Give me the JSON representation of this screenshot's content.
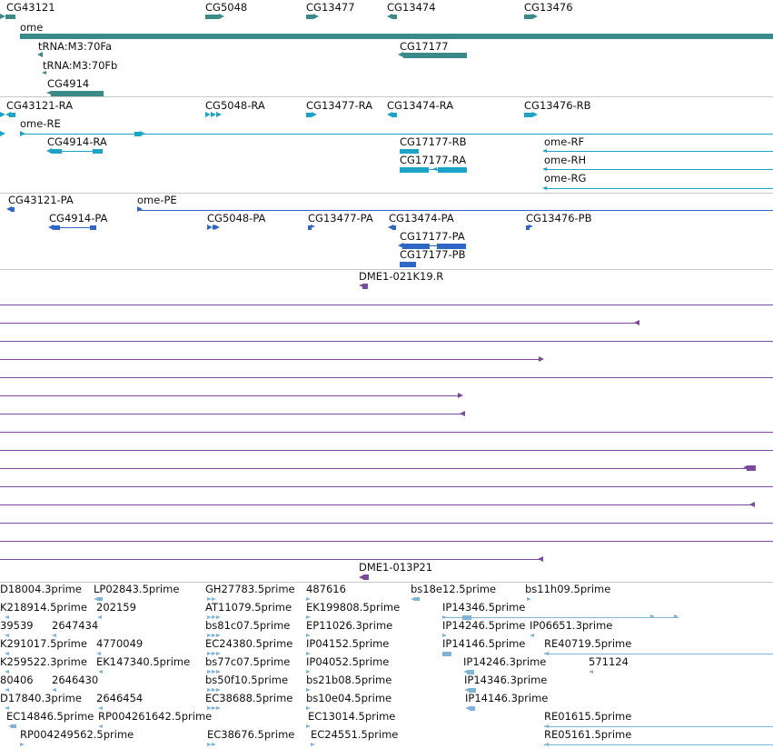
{
  "colors": {
    "gene": "#3a8a89",
    "mrna": "#1ba3c8",
    "protein": "#2f67c4",
    "clone": "#7a4a9c",
    "est": "#7fb4d9"
  },
  "sections": {
    "genes": {
      "labels": [
        "CG43121",
        "CG5048",
        "CG13477",
        "CG13474",
        "CG13476",
        "ome",
        "tRNA:M3:70Fa",
        "CG17177",
        "tRNA:M3:70Fb",
        "CG4914"
      ]
    },
    "mrnas": {
      "labels": [
        "CG43121-RA",
        "CG5048-RA",
        "CG13477-RA",
        "CG13474-RA",
        "CG13476-RB",
        "ome-RE",
        "CG4914-RA",
        "CG17177-RB",
        "ome-RF",
        "CG17177-RA",
        "ome-RH",
        "ome-RG"
      ]
    },
    "proteins": {
      "labels": [
        "CG43121-PA",
        "ome-PE",
        "CG4914-PA",
        "CG5048-PA",
        "CG13477-PA",
        "CG13474-PA",
        "CG13476-PB",
        "CG17177-PA",
        "CG17177-PB"
      ]
    },
    "clones": {
      "labels": [
        "DME1-021K19.R",
        "DME1-013P21"
      ]
    },
    "ests": {
      "labels": [
        "D18004.3prime",
        "LP02843.5prime",
        "GH27783.5prime",
        "487616",
        "bs18e12.5prime",
        "bs11h09.5prime",
        "K218914.5prime",
        "202159",
        "AT11079.5prime",
        "EK199808.5prime",
        "IP14346.5prime",
        "39539",
        "2647434",
        "bs81c07.5prime",
        "EP11026.3prime",
        "IP14246.5prime",
        "IP06651.3prime",
        "K291017.5prime",
        "4770049",
        "EC24380.5prime",
        "IP04152.5prime",
        "IP14146.5prime",
        "RE40719.5prime",
        "K259522.3prime",
        "EK147340.5prime",
        "bs77c07.5prime",
        "IP04052.5prime",
        "IP14246.3prime",
        "571124",
        "80406",
        "2646430",
        "bs50f10.5prime",
        "bs21b08.5prime",
        "IP14346.3prime",
        "D17840.3prime",
        "2646454",
        "EC38688.5prime",
        "bs10e04.5prime",
        "IP14146.3prime",
        "EC14846.5prime",
        "RP004261642.5prime",
        "EC13014.5prime",
        "RE01615.5prime",
        "RP004249562.5prime",
        "EC38676.5prime",
        "EC24551.5prime",
        "RE05161.5prime"
      ]
    }
  }
}
